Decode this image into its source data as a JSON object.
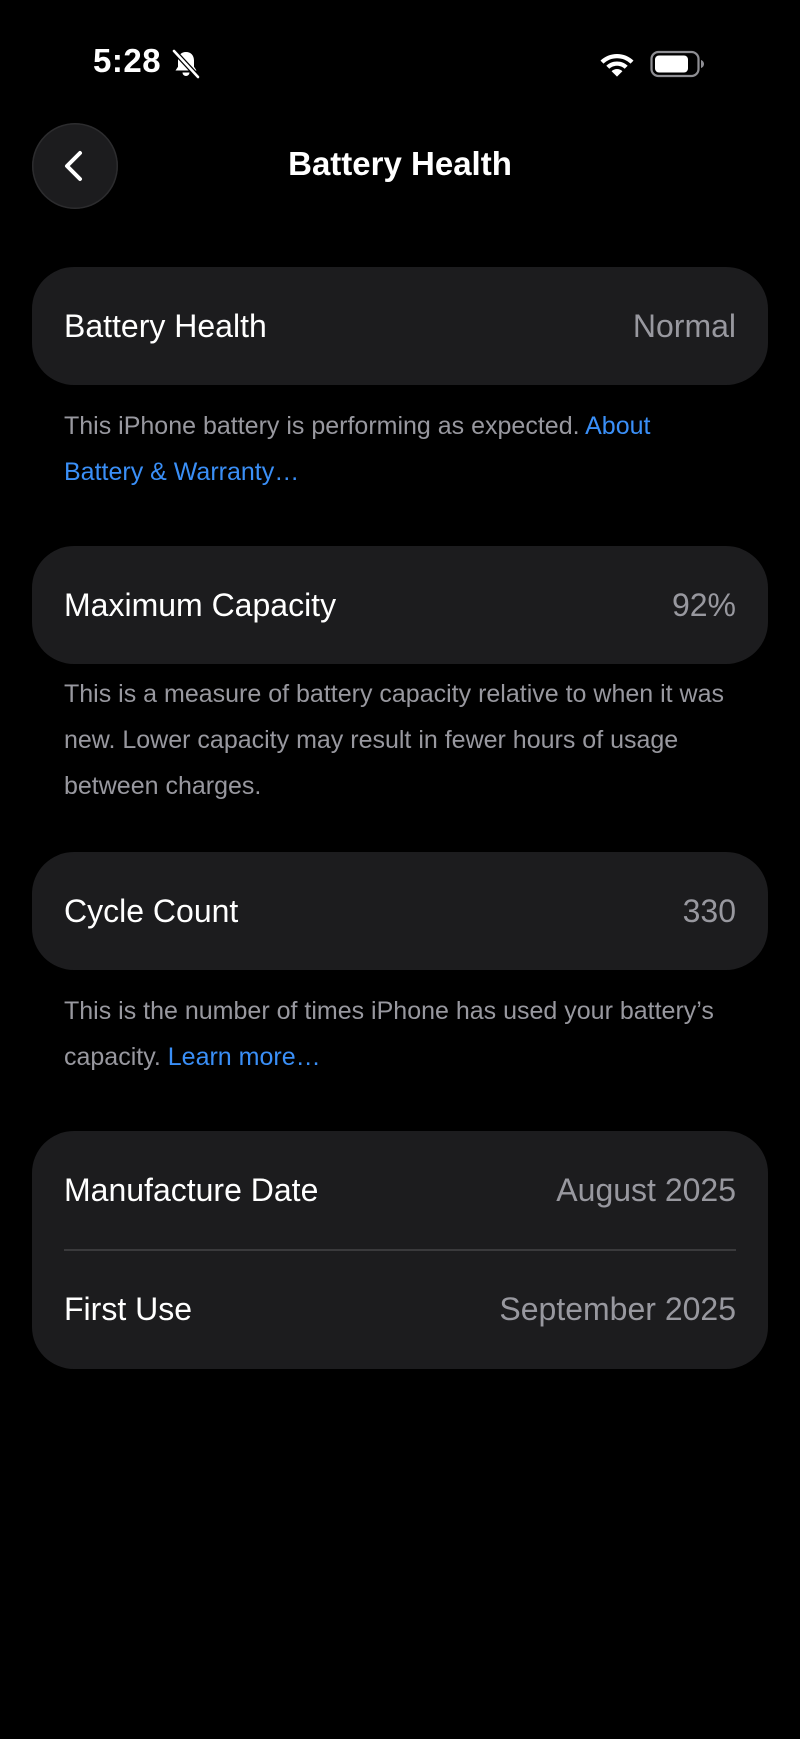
{
  "status_bar": {
    "time": "5:28",
    "icons": [
      "bell-slash-icon",
      "wifi-icon",
      "battery-icon"
    ]
  },
  "nav": {
    "title": "Battery Health",
    "back_icon": "chevron-left-icon"
  },
  "battery_health": {
    "label": "Battery Health",
    "value": "Normal",
    "description": "This iPhone battery is performing as expected.",
    "link": "About Battery & Warranty…"
  },
  "max_capacity": {
    "label": "Maximum Capacity",
    "value": "92%",
    "description": "This is a measure of battery capacity relative to when it was new. Lower capacity may result in fewer hours of usage between charges."
  },
  "cycle_count": {
    "label": "Cycle Count",
    "value": "330",
    "description": "This is the number of times iPhone has used your battery’s capacity.",
    "link": "Learn more…"
  },
  "dates": {
    "manufacture_label": "Manufacture Date",
    "manufacture_value": "August 2025",
    "first_use_label": "First Use",
    "first_use_value": "September 2025"
  },
  "colors": {
    "background": "#000000",
    "card": "#1c1c1e",
    "secondary_text": "#98989f",
    "link": "#3a8ff7",
    "divider": "#3a3a3c"
  }
}
